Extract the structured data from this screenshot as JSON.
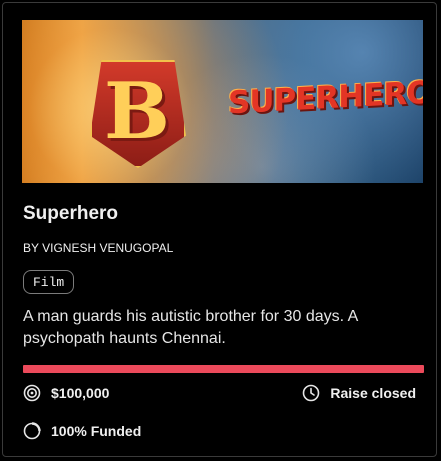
{
  "project": {
    "banner_text": "SUPERHERO",
    "banner_letter": "B",
    "title": "Superhero",
    "byline": "BY VIGNESH VENUGOPAL",
    "tag": "Film",
    "description": "A man guards his autistic brother for 30 days. A psychopath haunts Chennai.",
    "funding_progress_percent": 100,
    "goal": "$100,000",
    "status": "Raise closed",
    "funded": "100% Funded"
  },
  "colors": {
    "progress": "#ec4a5b",
    "background": "#000000",
    "text": "#f0f0f0"
  },
  "icons": {
    "goal": "target-icon",
    "status": "clock-icon",
    "funded": "progress-ring-icon"
  }
}
